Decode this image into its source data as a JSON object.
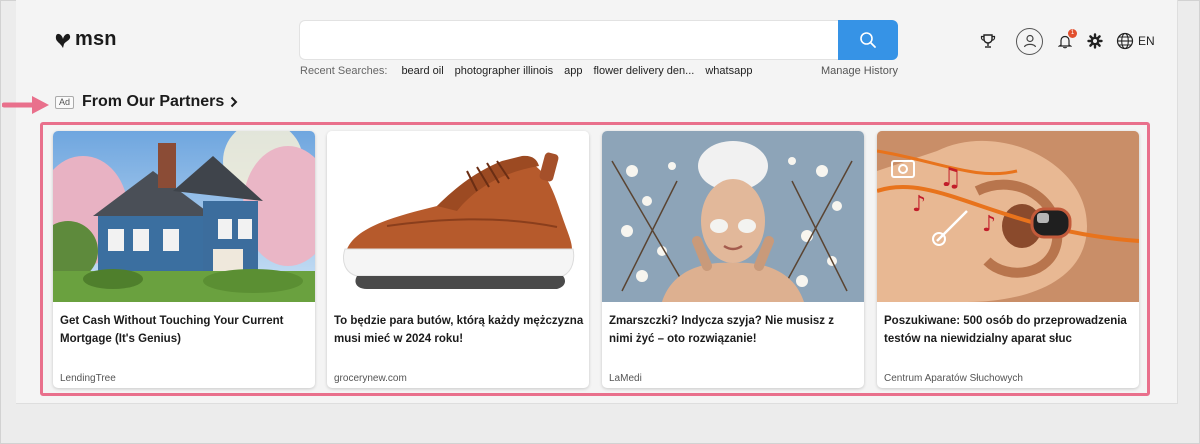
{
  "header": {
    "logo_text": "msn",
    "search": {
      "value": "",
      "placeholder": ""
    },
    "recent_label": "Recent Searches:",
    "recent_searches": [
      "beard oil",
      "photographer illinois",
      "app",
      "flower delivery den...",
      "whatsapp"
    ],
    "manage_history": "Manage History",
    "notification_count": "1",
    "language": "EN",
    "icons": [
      "trophy-icon",
      "profile-icon",
      "bell-icon",
      "gear-icon",
      "globe-icon",
      "search-icon"
    ]
  },
  "section": {
    "ad_label": "Ad",
    "title": "From Our Partners"
  },
  "cards": [
    {
      "title": "Get Cash Without Touching Your Current Mortgage (It's Genius)",
      "source": "LendingTree",
      "image": "house-photo"
    },
    {
      "title": "To będzie para butów, którą każdy mężczyzna musi mieć w 2024 roku!",
      "source": "grocerynew.com",
      "image": "sneaker-photo"
    },
    {
      "title": "Zmarszczki? Indycza szyja? Nie musisz z nimi żyć – oto rozwiązanie!",
      "source": "LaMedi",
      "image": "face-mask-photo"
    },
    {
      "title": "Poszukiwane: 500 osób do przeprowadzenia testów na niewidzialny aparat słuc",
      "source": "Centrum Aparatów Słuchowych",
      "image": "hearing-aid-photo"
    }
  ],
  "colors": {
    "accent_blue": "#3693e6",
    "highlight_pink": "#e9708c",
    "badge_red": "#e2502f"
  }
}
